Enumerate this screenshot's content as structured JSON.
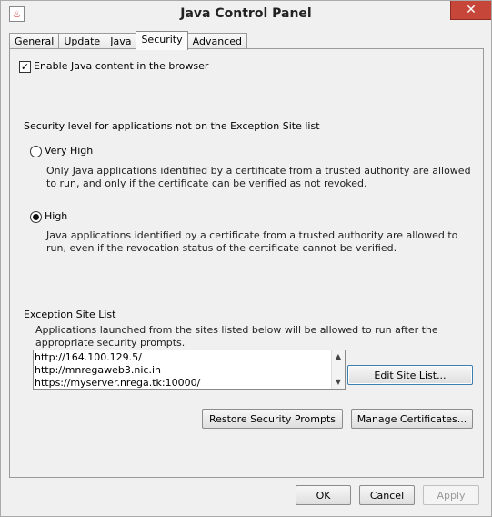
{
  "window": {
    "title": "Java Control Panel",
    "close_glyph": "✕"
  },
  "tabs": [
    {
      "label": "General"
    },
    {
      "label": "Update"
    },
    {
      "label": "Java"
    },
    {
      "label": "Security",
      "active": true
    },
    {
      "label": "Advanced"
    }
  ],
  "security": {
    "enable_label": "Enable Java content in the browser",
    "enable_checked": true,
    "level_heading": "Security level for applications not on the Exception Site list",
    "very_high": {
      "label": "Very High",
      "description": "Only Java applications identified by a certificate from a trusted authority are allowed to run, and only if the certificate can be verified as not revoked."
    },
    "high": {
      "label": "High",
      "selected": true,
      "description": "Java applications identified by a certificate from a trusted authority are allowed to run, even if the revocation status of the certificate cannot be verified."
    },
    "exception": {
      "heading": "Exception Site List",
      "description": "Applications launched from the sites listed below will be allowed to run after the appropriate security prompts.",
      "sites": [
        "http://164.100.129.5/",
        "http://mnregaweb3.nic.in",
        "https://myserver.nrega.tk:10000/"
      ],
      "edit_button": "Edit Site List..."
    },
    "restore_button": "Restore Security Prompts",
    "manage_button": "Manage Certificates..."
  },
  "footer": {
    "ok": "OK",
    "cancel": "Cancel",
    "apply": "Apply"
  },
  "colors": {
    "close_button": "#c7463a",
    "focus_border": "#3c7fb1"
  },
  "icons": {
    "app": "java-icon",
    "close": "close-icon",
    "scroll_up": "chevron-up-icon",
    "scroll_down": "chevron-down-icon"
  }
}
